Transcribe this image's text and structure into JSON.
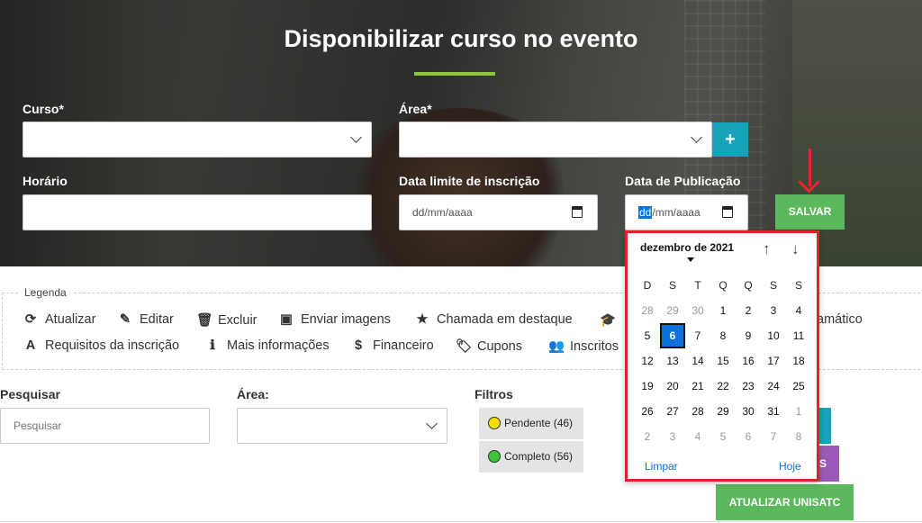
{
  "page": {
    "title": "Disponibilizar curso no evento"
  },
  "form": {
    "curso_label": "Curso*",
    "area_label": "Área*",
    "horario_label": "Horário",
    "data_limite_label": "Data limite de inscrição",
    "data_limite_value": "dd/mm/aaaa",
    "data_pub_label": "Data de Publicação",
    "data_pub_sel": "dd",
    "data_pub_rest": "/mm/aaaa",
    "plus_label": "+",
    "save_label": "SALVAR"
  },
  "legend": {
    "title": "Legenda",
    "items": [
      {
        "label": "Atualizar",
        "icon": "refresh-icon",
        "glyph": "⟳"
      },
      {
        "label": "Editar",
        "icon": "edit-icon",
        "glyph": "✎"
      },
      {
        "label": "Excluir",
        "icon": "trash-icon",
        "glyph": "🗑"
      },
      {
        "label": "Enviar imagens",
        "icon": "image-icon",
        "glyph": "▣"
      },
      {
        "label": "Chamada em destaque",
        "icon": "star-icon",
        "glyph": "★"
      },
      {
        "label": "",
        "icon": "graduation-cap-icon",
        "glyph": "🎓"
      },
      {
        "label": "amático",
        "icon": "",
        "glyph": ""
      },
      {
        "label": "Requisitos da inscrição",
        "icon": "font-icon",
        "glyph": "A"
      },
      {
        "label": "Mais informações",
        "icon": "info-icon",
        "glyph": "ℹ"
      },
      {
        "label": "Financeiro",
        "icon": "dollar-icon",
        "glyph": "$"
      },
      {
        "label": "Cupons",
        "icon": "tags-icon",
        "glyph": "🏷"
      },
      {
        "label": "Inscritos",
        "icon": "users-icon",
        "glyph": "👥"
      }
    ]
  },
  "filters": {
    "pesquisar_label": "Pesquisar",
    "pesquisar_placeholder": "Pesquisar",
    "area_label": "Área:",
    "filtros_label": "Filtros",
    "pendente": "Pendente (46)",
    "completo": "Completo (56)",
    "atualizar_unisatc": "ATUALIZAR UNISATC",
    "partial_btn": "S"
  },
  "calendar": {
    "month": "dezembro de 2021",
    "clear": "Limpar",
    "today": "Hoje",
    "weekdays": [
      "D",
      "S",
      "T",
      "Q",
      "Q",
      "S",
      "S"
    ],
    "weeks": [
      [
        {
          "d": "28",
          "m": true
        },
        {
          "d": "29",
          "m": true
        },
        {
          "d": "30",
          "m": true
        },
        {
          "d": "1"
        },
        {
          "d": "2"
        },
        {
          "d": "3"
        },
        {
          "d": "4"
        }
      ],
      [
        {
          "d": "5"
        },
        {
          "d": "6",
          "t": true
        },
        {
          "d": "7"
        },
        {
          "d": "8"
        },
        {
          "d": "9"
        },
        {
          "d": "10"
        },
        {
          "d": "11"
        }
      ],
      [
        {
          "d": "12"
        },
        {
          "d": "13"
        },
        {
          "d": "14"
        },
        {
          "d": "15"
        },
        {
          "d": "16"
        },
        {
          "d": "17"
        },
        {
          "d": "18"
        }
      ],
      [
        {
          "d": "19"
        },
        {
          "d": "20"
        },
        {
          "d": "21"
        },
        {
          "d": "22"
        },
        {
          "d": "23"
        },
        {
          "d": "24"
        },
        {
          "d": "25"
        }
      ],
      [
        {
          "d": "26"
        },
        {
          "d": "27"
        },
        {
          "d": "28"
        },
        {
          "d": "29"
        },
        {
          "d": "30"
        },
        {
          "d": "31"
        },
        {
          "d": "1",
          "m": true
        }
      ],
      [
        {
          "d": "2",
          "m": true
        },
        {
          "d": "3",
          "m": true
        },
        {
          "d": "4",
          "m": true
        },
        {
          "d": "5",
          "m": true
        },
        {
          "d": "6",
          "m": true
        },
        {
          "d": "7",
          "m": true
        },
        {
          "d": "8",
          "m": true
        }
      ]
    ]
  },
  "colors": {
    "accent_green": "#5cb85c",
    "teal": "#17a2b8",
    "purple": "#9b59b6",
    "highlight_red": "#e0232a"
  }
}
